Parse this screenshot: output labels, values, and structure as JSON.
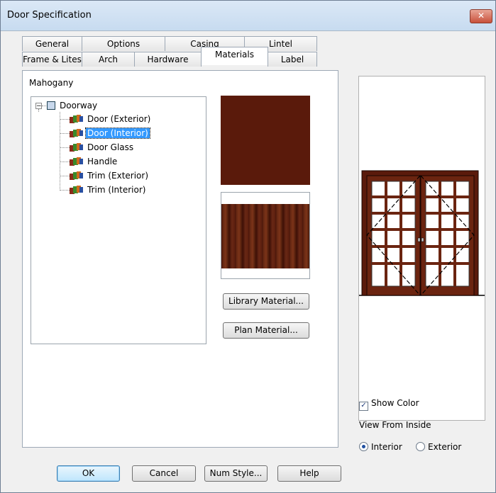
{
  "window": {
    "title": "Door Specification",
    "close_glyph": "✕"
  },
  "tabs": {
    "row1": [
      "General",
      "Options",
      "Casing",
      "Lintel"
    ],
    "row2": [
      "Frame & Lites",
      "Arch",
      "Hardware",
      "Materials",
      "Label"
    ],
    "active": "Materials"
  },
  "materials": {
    "current_material": "Mahogany",
    "tree": {
      "root": "Doorway",
      "expander": "−",
      "items": [
        "Door (Exterior)",
        "Door (Interior)",
        "Door Glass",
        "Handle",
        "Trim (Exterior)",
        "Trim (Interior)"
      ],
      "selected": "Door (Interior)"
    },
    "buttons": {
      "library": "Library Material...",
      "plan": "Plan Material..."
    },
    "swatch_color": "#5a1a0b"
  },
  "options": {
    "show_color": {
      "label": "Show Color",
      "checked": true,
      "check_glyph": "✓"
    },
    "view_from_label": "View From Inside",
    "view_options": [
      {
        "label": "Interior",
        "selected": true
      },
      {
        "label": "Exterior",
        "selected": false
      }
    ]
  },
  "footer": {
    "ok": "OK",
    "cancel": "Cancel",
    "num_style": "Num Style...",
    "help": "Help"
  }
}
